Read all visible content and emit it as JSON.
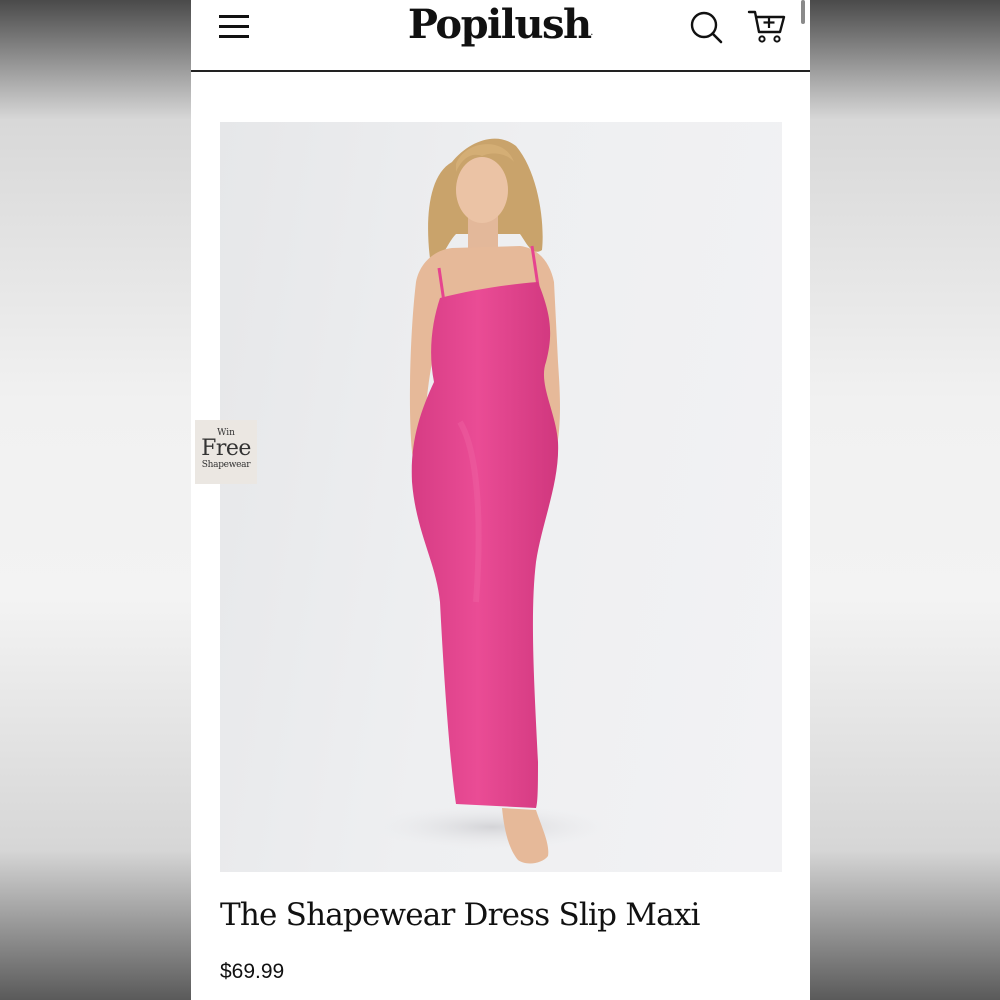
{
  "header": {
    "brand": "Popilush",
    "trademark": ".",
    "icons": {
      "menu": "hamburger-menu-icon",
      "search": "search-icon",
      "cart": "cart-add-icon"
    }
  },
  "promo": {
    "line1": "Win",
    "line2": "Free",
    "line3": "Shapewear"
  },
  "product": {
    "image_alt": "Model wearing pink shapewear slip maxi dress",
    "dress_color": "#e6448f",
    "title": "The Shapewear Dress Slip Maxi",
    "price": "$69.99"
  }
}
